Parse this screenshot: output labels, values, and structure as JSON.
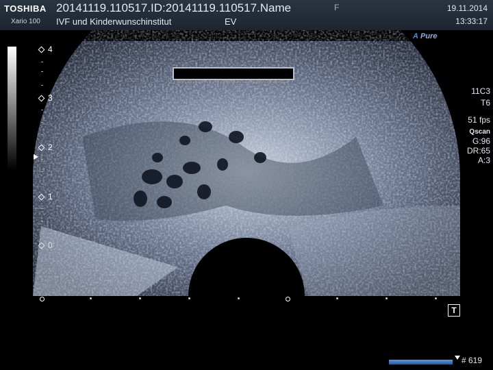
{
  "header": {
    "brand": "TOSHIBA",
    "model": "Xario 100",
    "title": "20141119.110517.ID:20141119.110517.Name",
    "clinic": "IVF und Kinderwunschinstitut",
    "mode": "EV",
    "flag": "F",
    "date": "19.11.2014",
    "time": "13:33:17"
  },
  "preset": {
    "prefix": "A",
    "name": "Pure"
  },
  "params": {
    "probe": "11C3",
    "setting": "T6",
    "fps": "51 fps",
    "qscan": "Qscan",
    "gain": "G:96",
    "dr": "DR:65",
    "a": "A:3"
  },
  "depth_scale": [
    "4",
    "3",
    "2",
    "1",
    "0"
  ],
  "cine": {
    "marker_label": "T",
    "frame": "# 619",
    "progress": 0.95
  },
  "colors": {
    "header_bg": "#222d39",
    "accent": "#4f8fd6"
  }
}
